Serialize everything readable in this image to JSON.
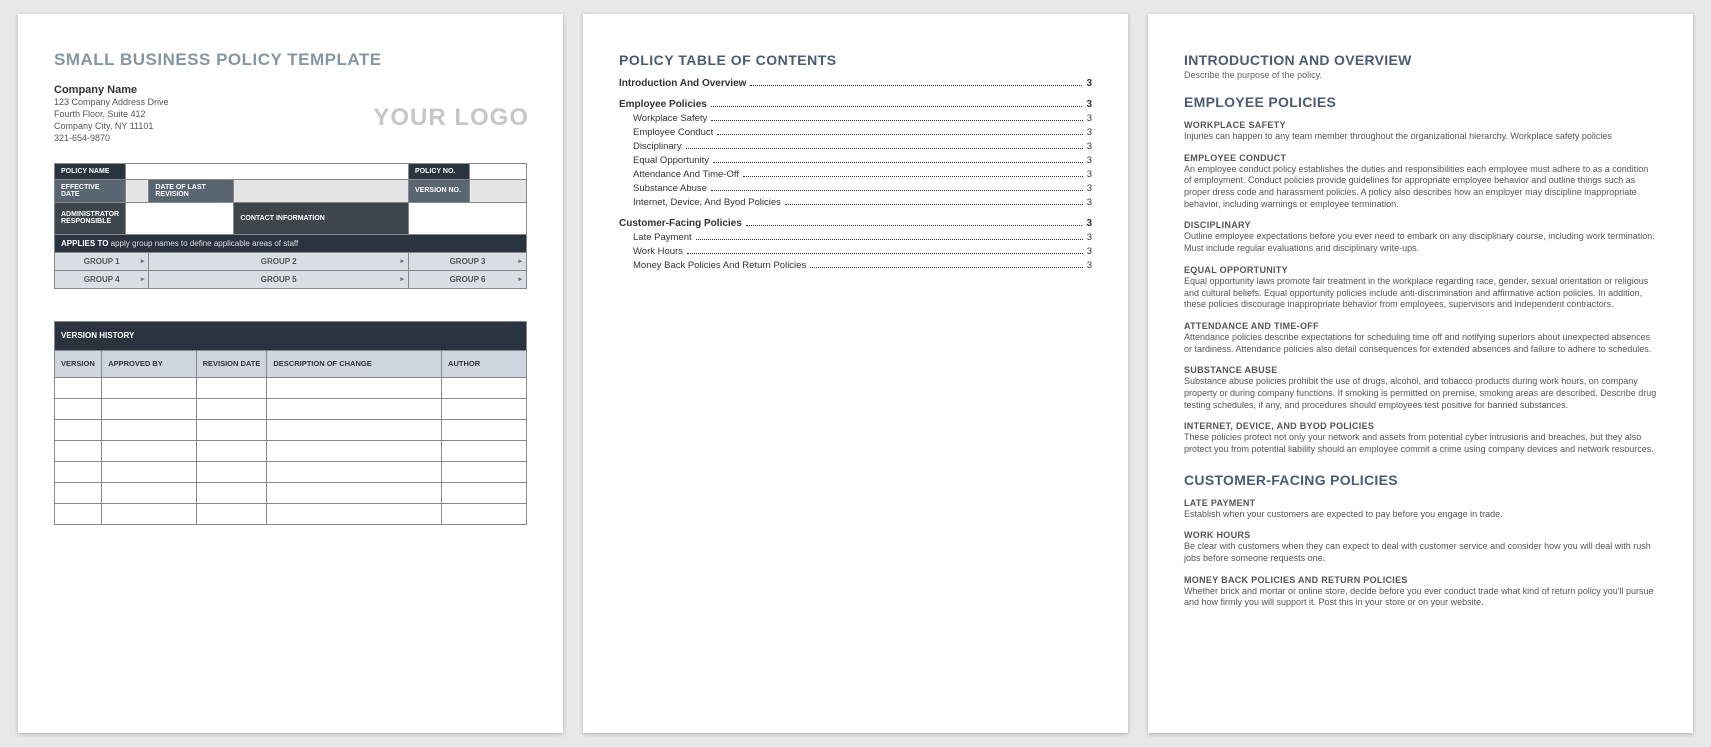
{
  "page1": {
    "title": "SMALL BUSINESS POLICY TEMPLATE",
    "company": "Company Name",
    "addr1": "123 Company Address Drive",
    "addr2": "Fourth Floor, Suite 412",
    "addr3": "Company City, NY  11101",
    "addr4": "321-654-9870",
    "logo": "YOUR LOGO",
    "labels": {
      "policy_name": "POLICY NAME",
      "policy_no": "POLICY NO.",
      "effective_date": "EFFECTIVE DATE",
      "date_last_revision": "DATE OF LAST REVISION",
      "version_no": "VERSION NO.",
      "admin_responsible": "ADMINISTRATOR RESPONSIBLE",
      "contact_info": "CONTACT INFORMATION",
      "applies_to": "APPLIES TO",
      "applies_to_hint": "apply group names to define applicable areas of staff"
    },
    "groups": [
      "GROUP 1",
      "GROUP 2",
      "GROUP 3",
      "GROUP 4",
      "GROUP 5",
      "GROUP 6"
    ],
    "version_history": {
      "title": "VERSION HISTORY",
      "cols": [
        "VERSION",
        "APPROVED BY",
        "REVISION DATE",
        "DESCRIPTION OF CHANGE",
        "AUTHOR"
      ]
    }
  },
  "page2": {
    "title": "POLICY TABLE OF CONTENTS",
    "toc": [
      {
        "lvl": 1,
        "txt": "Introduction And Overview",
        "pg": "3"
      },
      {
        "lvl": 1,
        "txt": "Employee Policies",
        "pg": "3"
      },
      {
        "lvl": 2,
        "txt": "Workplace Safety",
        "pg": "3"
      },
      {
        "lvl": 2,
        "txt": "Employee Conduct",
        "pg": "3"
      },
      {
        "lvl": 2,
        "txt": "Disciplinary",
        "pg": "3"
      },
      {
        "lvl": 2,
        "txt": "Equal Opportunity",
        "pg": "3"
      },
      {
        "lvl": 2,
        "txt": "Attendance And Time-Off",
        "pg": "3"
      },
      {
        "lvl": 2,
        "txt": "Substance Abuse",
        "pg": "3"
      },
      {
        "lvl": 2,
        "txt": "Internet, Device, And Byod Policies",
        "pg": "3"
      },
      {
        "lvl": 1,
        "txt": "Customer-Facing Policies",
        "pg": "3"
      },
      {
        "lvl": 2,
        "txt": "Late Payment",
        "pg": "3"
      },
      {
        "lvl": 2,
        "txt": "Work Hours",
        "pg": "3"
      },
      {
        "lvl": 2,
        "txt": "Money Back Policies And Return Policies",
        "pg": "3"
      }
    ]
  },
  "page3": {
    "intro_title": "INTRODUCTION AND OVERVIEW",
    "intro_sub": "Describe the purpose of the policy.",
    "emp_title": "EMPLOYEE POLICIES",
    "emp_policies": [
      {
        "h": "WORKPLACE SAFETY",
        "b": "Injuries can happen to any team member throughout the organizational hierarchy. Workplace safety policies"
      },
      {
        "h": "EMPLOYEE CONDUCT",
        "b": "An employee conduct policy establishes the duties and responsibilities each employee must adhere to as a condition of employment. Conduct policies provide guidelines for appropriate employee behavior and outline things such as proper dress code and harassment policies. A policy also describes how an employer may discipline inappropriate behavior, including warnings or employee termination."
      },
      {
        "h": "DISCIPLINARY",
        "b": "Outline employee expectations before you ever need to embark on any disciplinary course, including work termination. Must include regular evaluations and disciplinary write-ups."
      },
      {
        "h": "EQUAL OPPORTUNITY",
        "b": "Equal opportunity laws promote fair treatment in the workplace regarding race, gender, sexual orientation or religious and cultural beliefs. Equal opportunity policies include anti-discrimination and affirmative action policies. In addition, these policies discourage inappropriate behavior from employees, supervisors and independent contractors."
      },
      {
        "h": "ATTENDANCE AND TIME-OFF",
        "b": "Attendance policies describe expectations for scheduling time off and notifying superiors about unexpected absences or tardiness. Attendance policies also detail consequences for extended absences and failure to adhere to schedules."
      },
      {
        "h": "SUBSTANCE ABUSE",
        "b": "Substance abuse policies prohibit the use of drugs, alcohol, and tobacco products during work hours, on company property or during company functions. If smoking is permitted on premise, smoking areas are described. Describe drug testing schedules, if any, and procedures should employees test positive for banned substances."
      },
      {
        "h": "INTERNET, DEVICE, AND BYOD POLICIES",
        "b": "These policies protect not only your network and assets from potential cyber intrusions and breaches, but they also protect you from potential liability should an employee commit a crime using company devices and network resources."
      }
    ],
    "cust_title": "CUSTOMER-FACING POLICIES",
    "cust_policies": [
      {
        "h": "LATE PAYMENT",
        "b": "Establish when your customers are expected to pay before you engage in trade."
      },
      {
        "h": "WORK HOURS",
        "b": "Be clear with customers when they can expect to deal with customer service and consider how you will deal with rush jobs before someone requests one."
      },
      {
        "h": "MONEY BACK POLICIES AND RETURN POLICIES",
        "b": "Whether brick and mortar or online store, decide before you ever conduct trade what kind of return policy you'll pursue and how firmly you will support it. Post this in your store or on your website."
      }
    ]
  }
}
